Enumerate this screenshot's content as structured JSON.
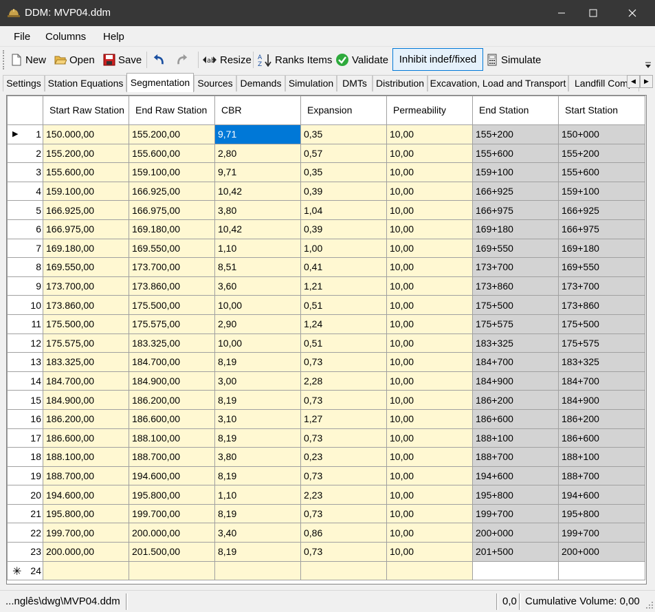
{
  "window": {
    "title": "DDM: MVP04.ddm",
    "icons": {
      "app": "hard-hat-icon",
      "minimize": "minimize-icon",
      "maximize": "maximize-icon",
      "close": "close-icon"
    }
  },
  "menu": {
    "items": [
      "File",
      "Columns",
      "Help"
    ]
  },
  "toolbar": {
    "new_label": "New",
    "open_label": "Open",
    "save_label": "Save",
    "resize_label": "Resize",
    "ranks_label": "Ranks Items",
    "validate_label": "Validate",
    "inhibit_label": "Inhibit indef/fixed",
    "simulate_label": "Simulate"
  },
  "tabs": [
    "Settings",
    "Station Equations",
    "Segmentation",
    "Sources",
    "Demands",
    "Simulation",
    "DMTs",
    "Distribution",
    "Excavation, Load and Transport",
    "Landfill Comp"
  ],
  "active_tab": "Segmentation",
  "grid": {
    "columns": [
      "Start Raw Station",
      "End Raw Station",
      "CBR",
      "Expansion",
      "Permeability",
      "End Station",
      "Start Station"
    ],
    "rows": [
      [
        "1",
        "150.000,00",
        "155.200,00",
        "9,71",
        "0,35",
        "10,00",
        "155+200",
        "150+000"
      ],
      [
        "2",
        "155.200,00",
        "155.600,00",
        "2,80",
        "0,57",
        "10,00",
        "155+600",
        "155+200"
      ],
      [
        "3",
        "155.600,00",
        "159.100,00",
        "9,71",
        "0,35",
        "10,00",
        "159+100",
        "155+600"
      ],
      [
        "4",
        "159.100,00",
        "166.925,00",
        "10,42",
        "0,39",
        "10,00",
        "166+925",
        "159+100"
      ],
      [
        "5",
        "166.925,00",
        "166.975,00",
        "3,80",
        "1,04",
        "10,00",
        "166+975",
        "166+925"
      ],
      [
        "6",
        "166.975,00",
        "169.180,00",
        "10,42",
        "0,39",
        "10,00",
        "169+180",
        "166+975"
      ],
      [
        "7",
        "169.180,00",
        "169.550,00",
        "1,10",
        "1,00",
        "10,00",
        "169+550",
        "169+180"
      ],
      [
        "8",
        "169.550,00",
        "173.700,00",
        "8,51",
        "0,41",
        "10,00",
        "173+700",
        "169+550"
      ],
      [
        "9",
        "173.700,00",
        "173.860,00",
        "3,60",
        "1,21",
        "10,00",
        "173+860",
        "173+700"
      ],
      [
        "10",
        "173.860,00",
        "175.500,00",
        "10,00",
        "0,51",
        "10,00",
        "175+500",
        "173+860"
      ],
      [
        "11",
        "175.500,00",
        "175.575,00",
        "2,90",
        "1,24",
        "10,00",
        "175+575",
        "175+500"
      ],
      [
        "12",
        "175.575,00",
        "183.325,00",
        "10,00",
        "0,51",
        "10,00",
        "183+325",
        "175+575"
      ],
      [
        "13",
        "183.325,00",
        "184.700,00",
        "8,19",
        "0,73",
        "10,00",
        "184+700",
        "183+325"
      ],
      [
        "14",
        "184.700,00",
        "184.900,00",
        "3,00",
        "2,28",
        "10,00",
        "184+900",
        "184+700"
      ],
      [
        "15",
        "184.900,00",
        "186.200,00",
        "8,19",
        "0,73",
        "10,00",
        "186+200",
        "184+900"
      ],
      [
        "16",
        "186.200,00",
        "186.600,00",
        "3,10",
        "1,27",
        "10,00",
        "186+600",
        "186+200"
      ],
      [
        "17",
        "186.600,00",
        "188.100,00",
        "8,19",
        "0,73",
        "10,00",
        "188+100",
        "186+600"
      ],
      [
        "18",
        "188.100,00",
        "188.700,00",
        "3,80",
        "0,23",
        "10,00",
        "188+700",
        "188+100"
      ],
      [
        "19",
        "188.700,00",
        "194.600,00",
        "8,19",
        "0,73",
        "10,00",
        "194+600",
        "188+700"
      ],
      [
        "20",
        "194.600,00",
        "195.800,00",
        "1,10",
        "2,23",
        "10,00",
        "195+800",
        "194+600"
      ],
      [
        "21",
        "195.800,00",
        "199.700,00",
        "8,19",
        "0,73",
        "10,00",
        "199+700",
        "195+800"
      ],
      [
        "22",
        "199.700,00",
        "200.000,00",
        "3,40",
        "0,86",
        "10,00",
        "200+000",
        "199+700"
      ],
      [
        "23",
        "200.000,00",
        "201.500,00",
        "8,19",
        "0,73",
        "10,00",
        "201+500",
        "200+000"
      ]
    ],
    "new_row_number": "24",
    "selected_row": 1,
    "selected_column": "CBR"
  },
  "colors": {
    "editable_cell": "#fff8d2",
    "readonly_cell": "#d3d3d3",
    "selection": "#0078d7",
    "titlebar": "#373737"
  },
  "status": {
    "path": "...nglês\\dwg\\MVP04.ddm",
    "coord": "0,0",
    "volume": "Cumulative Volume: 0,00"
  }
}
